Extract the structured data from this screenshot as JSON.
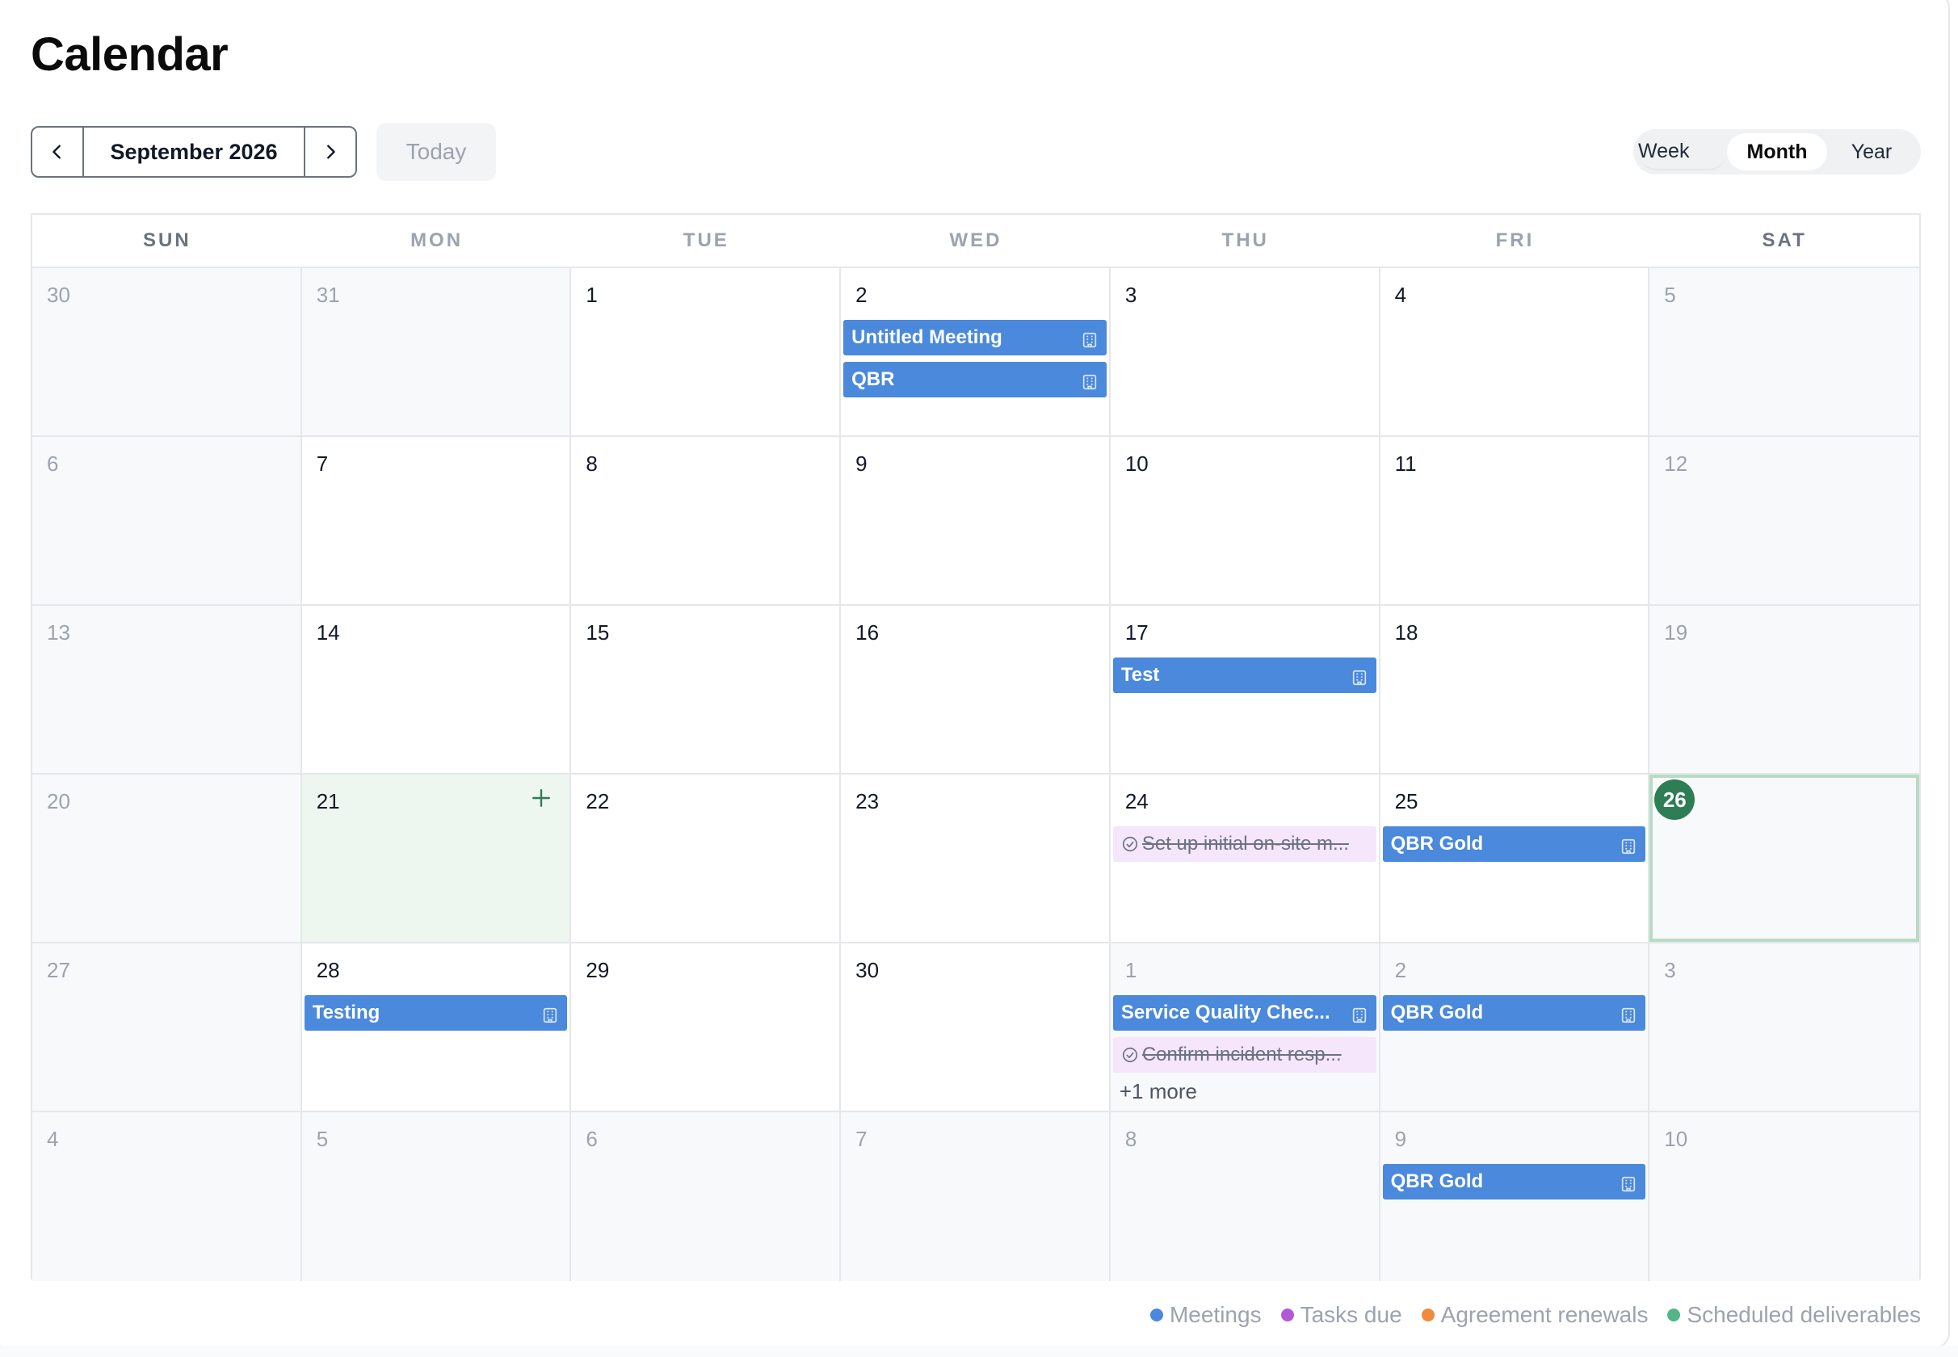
{
  "title": "Calendar",
  "nav": {
    "period_label": "September 2026",
    "prev_icon": "chevron-left-icon",
    "next_icon": "chevron-right-icon",
    "today_label": "Today"
  },
  "views": {
    "week": "Week",
    "month": "Month",
    "year": "Year",
    "active": "Month"
  },
  "weekdays": [
    "SUN",
    "MON",
    "TUE",
    "WED",
    "THU",
    "FRI",
    "SAT"
  ],
  "colors": {
    "meeting": "#4a89dc",
    "task_bg": "#f5e6fb",
    "today": "#2e7d55",
    "selected_bg": "#eef6f0",
    "legend_meetings": "#4a89dc",
    "legend_tasks": "#b05ad6",
    "legend_agreements": "#f08a3c",
    "legend_deliverables": "#52b788"
  },
  "weeks": [
    [
      {
        "n": "30",
        "muted": true
      },
      {
        "n": "31",
        "muted": true
      },
      {
        "n": "1"
      },
      {
        "n": "2",
        "events": [
          {
            "type": "meeting",
            "label": "Untitled Meeting"
          },
          {
            "type": "meeting",
            "label": "QBR"
          }
        ]
      },
      {
        "n": "3"
      },
      {
        "n": "4"
      },
      {
        "n": "5",
        "muted": true
      }
    ],
    [
      {
        "n": "6",
        "muted": true
      },
      {
        "n": "7"
      },
      {
        "n": "8"
      },
      {
        "n": "9"
      },
      {
        "n": "10"
      },
      {
        "n": "11"
      },
      {
        "n": "12",
        "muted": true
      }
    ],
    [
      {
        "n": "13",
        "muted": true
      },
      {
        "n": "14"
      },
      {
        "n": "15"
      },
      {
        "n": "16"
      },
      {
        "n": "17",
        "events": [
          {
            "type": "meeting",
            "label": "Test"
          }
        ]
      },
      {
        "n": "18"
      },
      {
        "n": "19",
        "muted": true
      }
    ],
    [
      {
        "n": "20",
        "muted": true
      },
      {
        "n": "21",
        "selected": true
      },
      {
        "n": "22"
      },
      {
        "n": "23"
      },
      {
        "n": "24",
        "events": [
          {
            "type": "task",
            "label": "Set up initial on-site m..."
          }
        ]
      },
      {
        "n": "25",
        "events": [
          {
            "type": "meeting",
            "label": "QBR Gold"
          }
        ]
      },
      {
        "n": "26",
        "today": true
      }
    ],
    [
      {
        "n": "27",
        "muted": true
      },
      {
        "n": "28",
        "events": [
          {
            "type": "meeting",
            "label": "Testing"
          }
        ]
      },
      {
        "n": "29"
      },
      {
        "n": "30"
      },
      {
        "n": "1",
        "muted": true,
        "events": [
          {
            "type": "meeting",
            "label": "Service Quality Chec..."
          },
          {
            "type": "task",
            "label": "Confirm incident resp..."
          }
        ],
        "more": "+1 more"
      },
      {
        "n": "2",
        "muted": true,
        "events": [
          {
            "type": "meeting",
            "label": "QBR Gold"
          }
        ]
      },
      {
        "n": "3",
        "muted": true
      }
    ],
    [
      {
        "n": "4",
        "muted": true
      },
      {
        "n": "5",
        "muted": true
      },
      {
        "n": "6",
        "muted": true
      },
      {
        "n": "7",
        "muted": true
      },
      {
        "n": "8",
        "muted": true
      },
      {
        "n": "9",
        "muted": true,
        "events": [
          {
            "type": "meeting",
            "label": "QBR Gold"
          }
        ]
      },
      {
        "n": "10",
        "muted": true
      }
    ]
  ],
  "legend": [
    {
      "label": "Meetings",
      "color": "#4a89dc"
    },
    {
      "label": "Tasks due",
      "color": "#b05ad6"
    },
    {
      "label": "Agreement renewals",
      "color": "#f08a3c"
    },
    {
      "label": "Scheduled deliverables",
      "color": "#52b788"
    }
  ]
}
